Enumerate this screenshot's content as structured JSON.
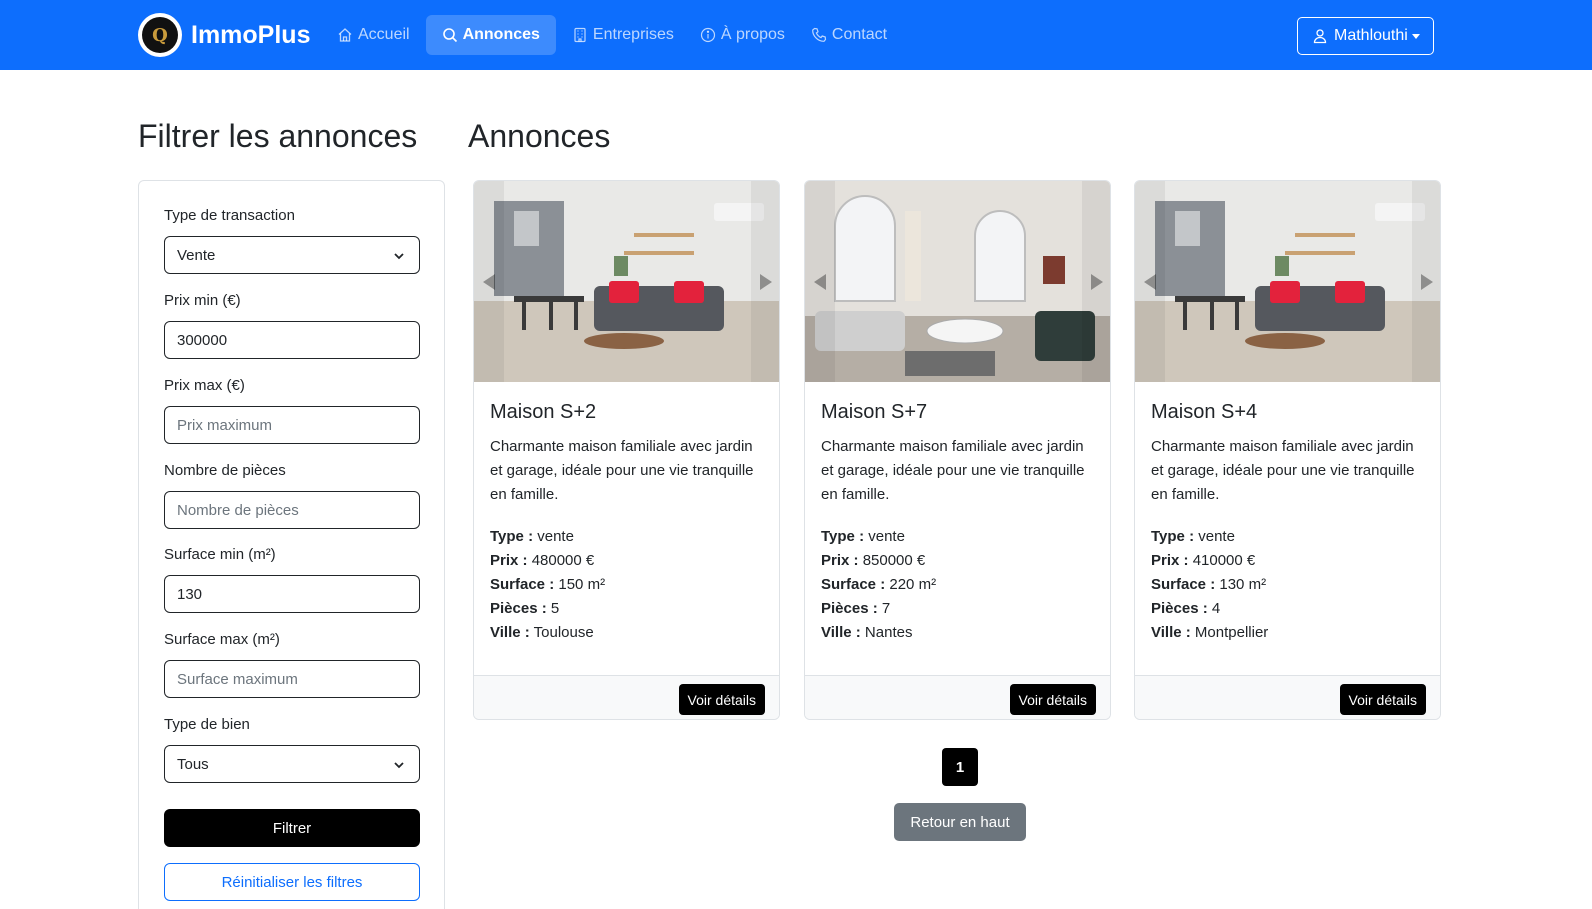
{
  "brand": {
    "name": "ImmoPlus",
    "logo_letter": "Q"
  },
  "nav": {
    "items": [
      {
        "label": "Accueil",
        "icon": "house-icon"
      },
      {
        "label": "Annonces",
        "icon": "search-icon"
      },
      {
        "label": "Entreprises",
        "icon": "building-icon"
      },
      {
        "label": "À propos",
        "icon": "info-circle-icon"
      },
      {
        "label": "Contact",
        "icon": "telephone-icon"
      }
    ],
    "active": "Annonces"
  },
  "user": {
    "label": "Mathlouthi"
  },
  "filters": {
    "heading": "Filtrer les annonces",
    "transaction_label": "Type de transaction",
    "transaction_value": "Vente",
    "prix_min_label": "Prix min (€)",
    "prix_min_value": "300000",
    "prix_max_label": "Prix max (€)",
    "prix_max_placeholder": "Prix maximum",
    "pieces_label": "Nombre de pièces",
    "pieces_placeholder": "Nombre de pièces",
    "surface_min_label": "Surface min (m²)",
    "surface_min_value": "130",
    "surface_max_label": "Surface max (m²)",
    "surface_max_placeholder": "Surface maximum",
    "bien_label": "Type de bien",
    "bien_value": "Tous",
    "filter_button": "Filtrer",
    "reset_button": "Réinitialiser les filtres"
  },
  "listings": {
    "heading": "Annonces",
    "labels": {
      "type": "Type :",
      "prix": "Prix :",
      "surface": "Surface :",
      "pieces": "Pièces :",
      "ville": "Ville :"
    },
    "details_button": "Voir détails",
    "cards": [
      {
        "title": "Maison S+2",
        "description": "Charmante maison familiale avec jardin et garage, idéale pour une vie tranquille en famille.",
        "type": "vente",
        "prix": "480000 €",
        "surface": "150 m²",
        "pieces": "5",
        "ville": "Toulouse"
      },
      {
        "title": "Maison S+7",
        "description": "Charmante maison familiale avec jardin et garage, idéale pour une vie tranquille en famille.",
        "type": "vente",
        "prix": "850000 €",
        "surface": "220 m²",
        "pieces": "7",
        "ville": "Nantes"
      },
      {
        "title": "Maison S+4",
        "description": "Charmante maison familiale avec jardin et garage, idéale pour une vie tranquille en famille.",
        "type": "vente",
        "prix": "410000 €",
        "surface": "130 m²",
        "pieces": "4",
        "ville": "Montpellier"
      }
    ]
  },
  "pagination": {
    "current": "1"
  },
  "back_to_top": "Retour en haut",
  "colors": {
    "primary": "#0d6efd",
    "dark": "#000000",
    "secondary": "#6c757d"
  }
}
